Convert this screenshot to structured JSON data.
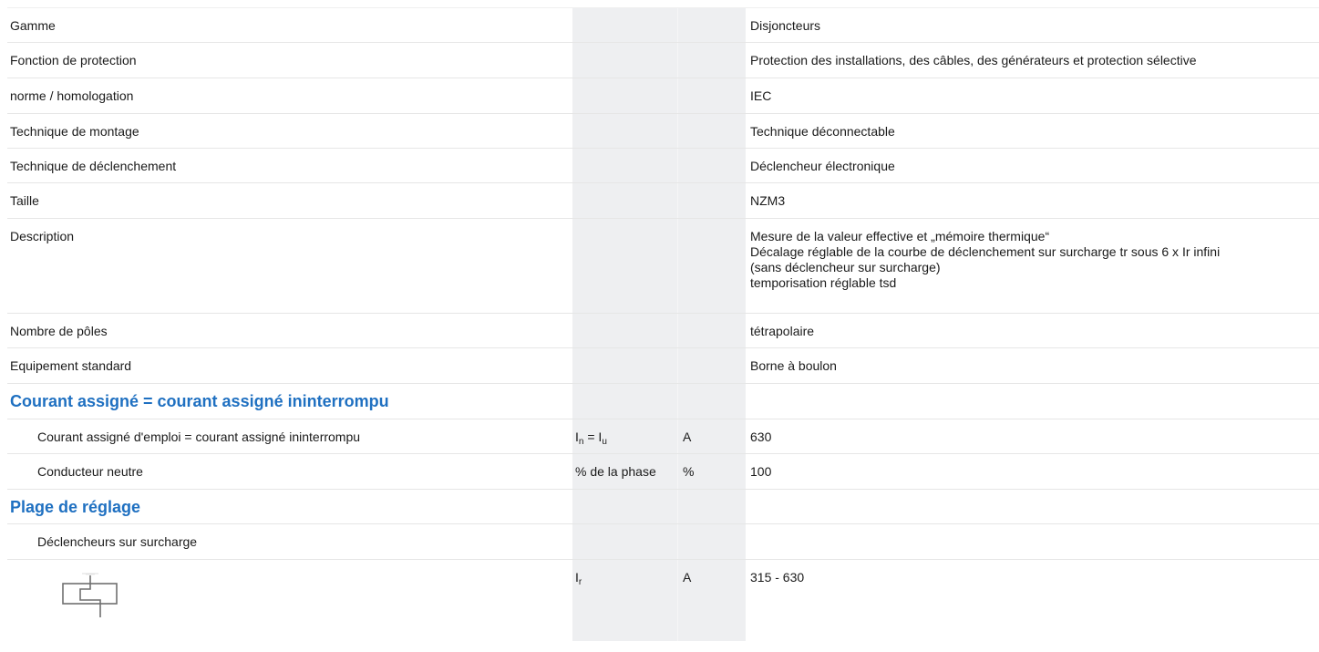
{
  "rows": [
    {
      "label": "Gamme",
      "value": "Disjoncteurs"
    },
    {
      "label": "Fonction de protection",
      "value": "Protection des installations, des câbles, des générateurs et protection sélective"
    },
    {
      "label": "norme / homologation",
      "value": "IEC"
    },
    {
      "label": "Technique de montage",
      "value": "Technique déconnectable"
    },
    {
      "label": "Technique de déclenchement",
      "value": "Déclencheur électronique"
    },
    {
      "label": "Taille",
      "value": "NZM3"
    },
    {
      "label": "Description",
      "value_lines": [
        "Mesure de la valeur effective et „mémoire thermique“",
        "Décalage réglable de la courbe de déclenchement sur surcharge tr sous 6 x Ir infini",
        "(sans déclencheur sur surcharge)",
        "temporisation réglable tsd"
      ]
    },
    {
      "label": "Nombre de pôles",
      "value": "tétrapolaire"
    },
    {
      "label": "Equipement standard",
      "value": "Borne à boulon"
    }
  ],
  "section_current": {
    "title": "Courant assigné = courant assigné ininterrompu",
    "rows": [
      {
        "label": "Courant assigné d'emploi = courant assigné ininterrompu",
        "symbol_main": "I",
        "symbol_sub": "n",
        "symbol_mid": " = I",
        "symbol_sub2": "u",
        "unit": "A",
        "value": "630"
      },
      {
        "label": "Conducteur neutre",
        "symbol_text": "% de la phase",
        "unit": "%",
        "value": "100"
      }
    ]
  },
  "section_range": {
    "title": "Plage de réglage",
    "sub_label": "Déclencheurs sur surcharge",
    "row": {
      "symbol_main": "I",
      "symbol_sub": "r",
      "unit": "A",
      "value": "315 - 630",
      "icon": "overload-release-symbol-icon"
    }
  }
}
